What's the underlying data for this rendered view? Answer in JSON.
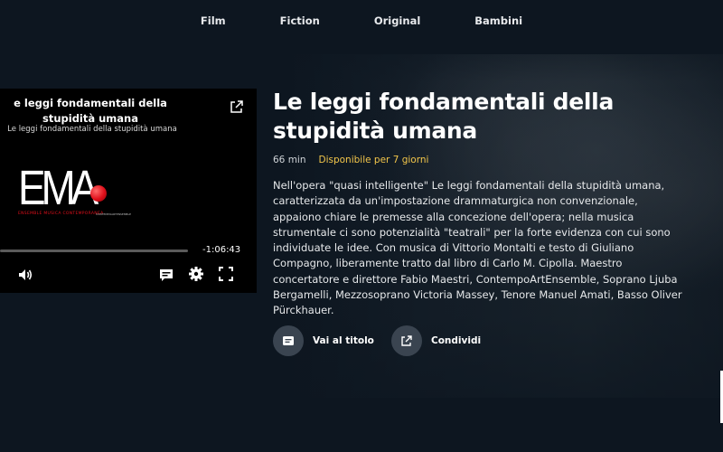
{
  "nav": {
    "items": [
      {
        "label": "Film"
      },
      {
        "label": "Fiction"
      },
      {
        "label": "Original"
      },
      {
        "label": "Bambini"
      }
    ]
  },
  "player": {
    "title": "e leggi fondamentali della stupidità umana",
    "subtitle": "Le leggi fondamentali della stupidità umana",
    "logo_text": "EMA",
    "logo_tagline": "ENSEMBLE MUSICA CONTEMPORANEA",
    "logo_small": "CONTEMPOARTENSEMBLE",
    "progress_fraction": 0.0,
    "time_remaining": "-1:06:43",
    "icons": [
      "share-icon",
      "volume-icon",
      "subtitles-icon",
      "settings-icon",
      "fullscreen-icon"
    ]
  },
  "details": {
    "title": "Le leggi fondamentali della stupidità umana",
    "duration": "66 min",
    "availability": "Disponibile per 7 giorni",
    "description": "Nell'opera \"quasi intelligente\" Le leggi fondamentali della stupidità umana, caratterizzata da un'impostazione drammaturgica non convenzionale, appaiono chiare le premesse alla concezione dell'opera; nella musica strumentale ci sono potenzialità \"teatrali\" per la forte evidenza con cui sono individuate le idee. Con musica di Vittorio Montalti e testo di Giuliano Compagno, liberamente tratto dal libro di Carlo M. Cipolla. Maestro concertatore e direttore Fabio Maestri, ContempoArtEnsemble, Soprano Ljuba Bergamelli, Mezzosoprano Victoria Massey, Tenore Manuel Amati, Basso Oliver Pürckhauer."
  },
  "actions": {
    "go_to_title": "Vai al titolo",
    "share": "Condividi"
  },
  "colors": {
    "background": "#0d1620",
    "accent_availability": "#f3c64a",
    "logo_red": "#e0101b",
    "action_circle": "#3a4450"
  }
}
